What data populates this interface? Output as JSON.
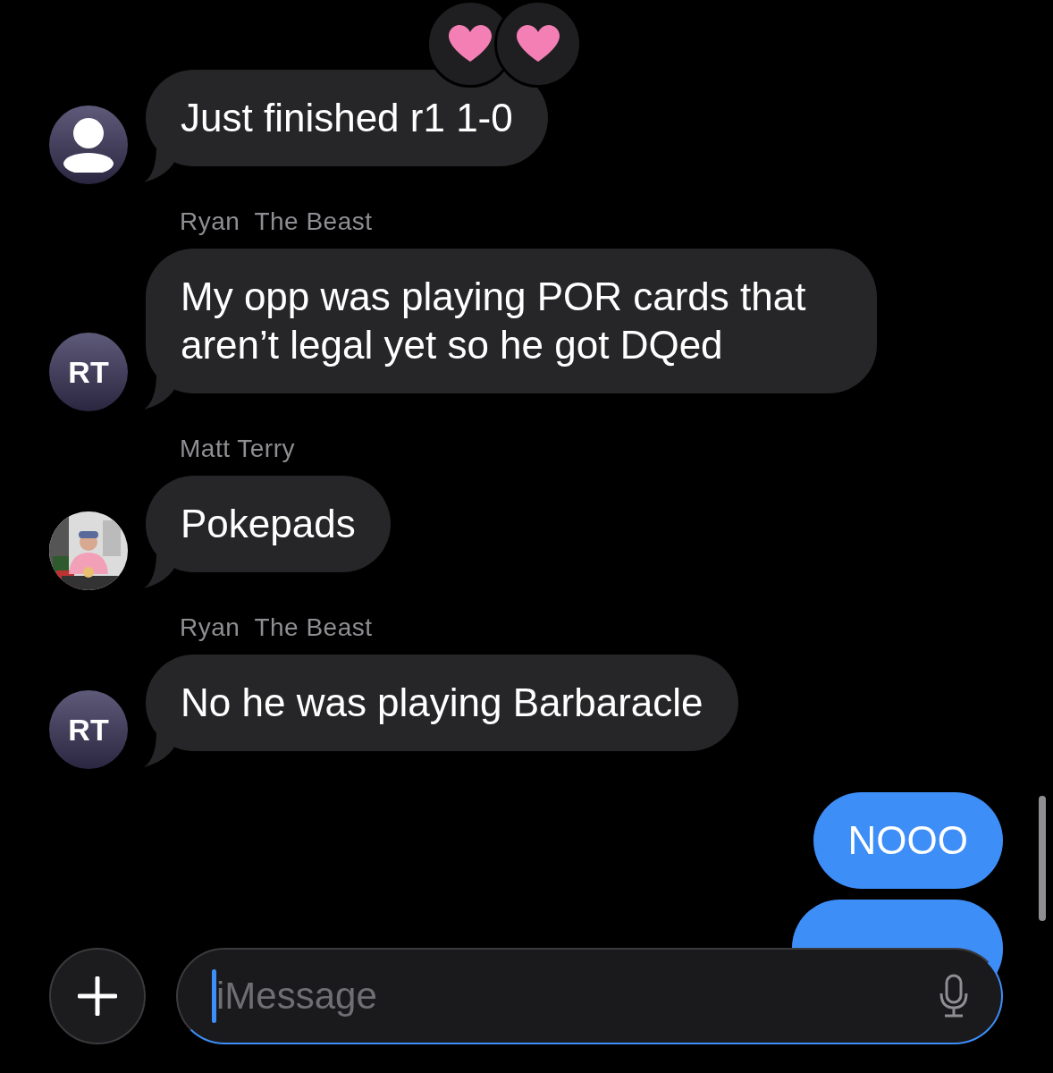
{
  "messages": [
    {
      "kind": "incoming",
      "avatar": {
        "kind": "silhouette"
      },
      "text": "Just finished r1 1-0",
      "reactions": [
        {
          "kind": "heart"
        },
        {
          "kind": "heart"
        }
      ]
    },
    {
      "kind": "incoming",
      "sender": "Ryan  The Beast",
      "avatar": {
        "kind": "initials",
        "initials": "RT"
      },
      "text": "My opp was playing POR cards that aren’t legal yet so he got DQed"
    },
    {
      "kind": "incoming",
      "sender": "Matt Terry",
      "text": "Pokepads"
    },
    {
      "kind": "incoming",
      "sender": "Ryan  The Beast",
      "avatar": {
        "kind": "initials",
        "initials": "RT"
      },
      "text": "No he was playing Barbaracle"
    },
    {
      "kind": "outgoing",
      "text": "NOOO"
    },
    {
      "kind": "outgoing_hidden"
    }
  ],
  "composer": {
    "placeholder": "iMessage"
  }
}
